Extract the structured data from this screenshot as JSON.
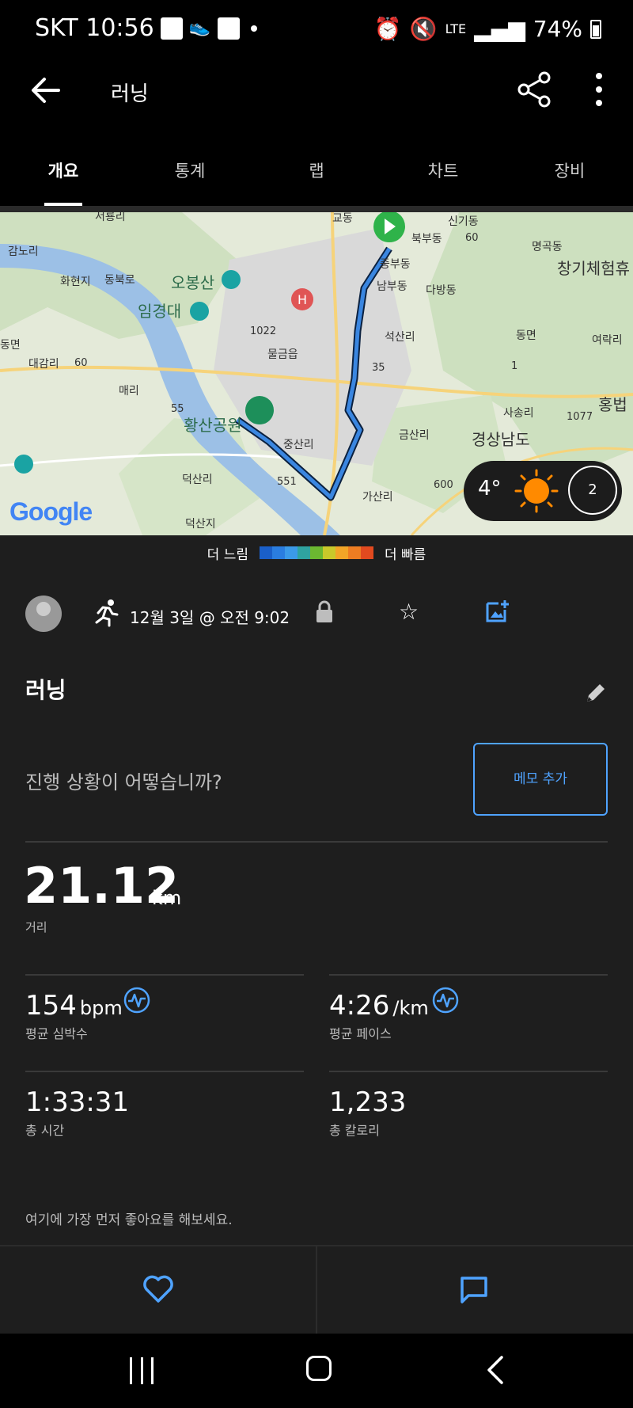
{
  "status_bar": {
    "carrier_time": "SKT 10:56",
    "network": "LTE",
    "battery": "74%"
  },
  "app_bar": {
    "title": "러닝"
  },
  "tabs": [
    {
      "label": "개요",
      "active": true
    },
    {
      "label": "통계",
      "active": false
    },
    {
      "label": "랩",
      "active": false
    },
    {
      "label": "차트",
      "active": false
    },
    {
      "label": "장비",
      "active": false
    }
  ],
  "map": {
    "logo": "Google",
    "labels": [
      "서룡리",
      "교동",
      "신기동",
      "북부동",
      "명곡동",
      "감노리",
      "화현지",
      "동북로",
      "오봉산",
      "창기체험휴",
      "중부동",
      "남부동",
      "다방동",
      "임경대",
      "1022",
      "석산리",
      "동면",
      "여락리",
      "대감리",
      "60",
      "물금읍",
      "35",
      "동면",
      "매리",
      "55",
      "황산공원",
      "중산리",
      "금산리",
      "사송리",
      "1077",
      "경상남도",
      "홍법",
      "덕산리",
      "551",
      "가산리",
      "600",
      "덕산지",
      "60",
      "1"
    ],
    "weather": {
      "temp": "4°",
      "speed": "2"
    }
  },
  "pace_legend": {
    "slower": "더 느림",
    "faster": "더 빠름",
    "colors": [
      "#1a5fc9",
      "#2a7de0",
      "#3b9ae8",
      "#2fa3a0",
      "#6bb831",
      "#c9c92a",
      "#f2a527",
      "#ee7d22",
      "#e24a1f"
    ]
  },
  "activity": {
    "date": "12월 3일 @ 오전 9:02",
    "name": "러닝",
    "prompt": "진행 상황이 어떻습니까?",
    "memo_button": "메모 추가",
    "distance": {
      "value": "21.12",
      "unit": "km",
      "label": "거리"
    },
    "stats": [
      {
        "value": "154",
        "unit": "bpm",
        "label": "평균 심박수"
      },
      {
        "value": "4:26",
        "unit": "/km",
        "label": "평균 페이스"
      },
      {
        "value": "1:33:31",
        "unit": "",
        "label": "총 시간"
      },
      {
        "value": "1,233",
        "unit": "",
        "label": "총 칼로리"
      }
    ],
    "likes_prompt": "여기에 가장 먼저 좋아요를 해보세요."
  },
  "colors": {
    "accent": "#4fa3ff",
    "background": "#1e1e1e",
    "route": "#3a86e0"
  }
}
